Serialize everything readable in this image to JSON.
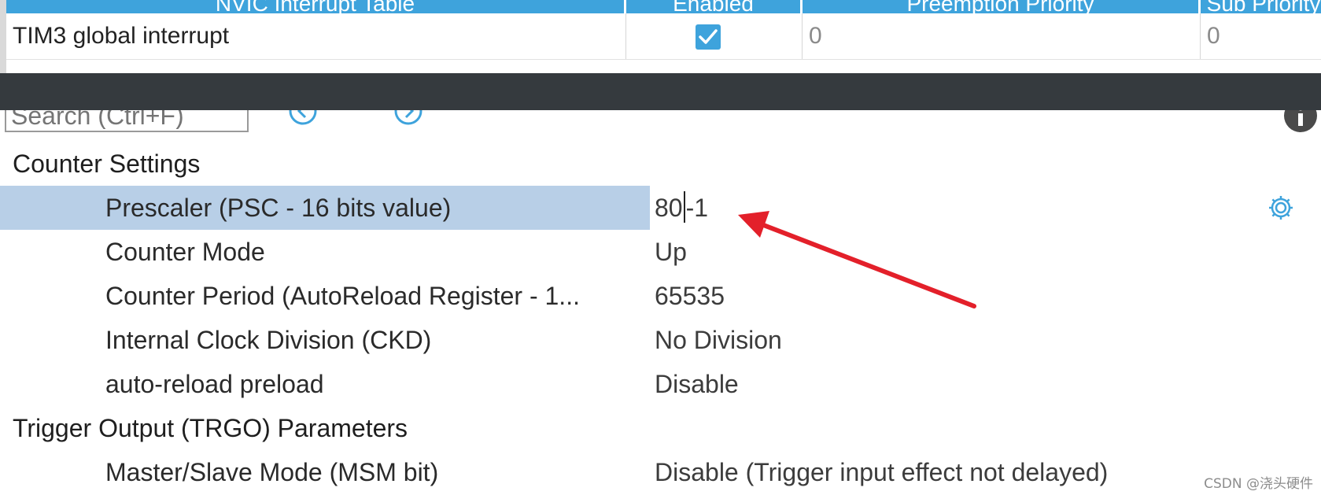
{
  "nvic_table": {
    "columns": [
      {
        "label": "NVIC Interrupt Table"
      },
      {
        "label": "Enabled"
      },
      {
        "label": "Preemption Priority"
      },
      {
        "label": "Sub Priority"
      }
    ],
    "rows": [
      {
        "interrupt": "TIM3 global interrupt",
        "enabled": true,
        "preemption_priority": "0",
        "sub_priority": "0"
      }
    ]
  },
  "search": {
    "placeholder": "Search (Ctrl+F)"
  },
  "parameters": {
    "groups": [
      {
        "label": "Counter Settings",
        "items": [
          {
            "name": "Prescaler (PSC - 16 bits value)",
            "value_before_caret": "80",
            "value_after_caret": "-1",
            "selected": true
          },
          {
            "name": "Counter Mode",
            "value": "Up"
          },
          {
            "name": "Counter Period (AutoReload Register - 1...",
            "value": "65535"
          },
          {
            "name": "Internal Clock Division (CKD)",
            "value": "No Division"
          },
          {
            "name": "auto-reload preload",
            "value": "Disable"
          }
        ]
      },
      {
        "label": "Trigger Output (TRGO) Parameters",
        "items": [
          {
            "name": "Master/Slave Mode (MSM bit)",
            "value": "Disable (Trigger input effect not delayed)"
          }
        ]
      }
    ]
  },
  "icons": {
    "checkbox": "checkbox-checked-icon",
    "nav_prev": "arrow-left-circle-icon",
    "nav_next": "arrow-right-circle-icon",
    "info": "info-icon",
    "gear": "gear-icon"
  },
  "colors": {
    "header_blue": "#3ea3dc",
    "selection": "#b8cfe7",
    "dark_band": "#353a3e",
    "arrow_red": "#e3202a"
  },
  "watermark": "CSDN @浇头硬件"
}
